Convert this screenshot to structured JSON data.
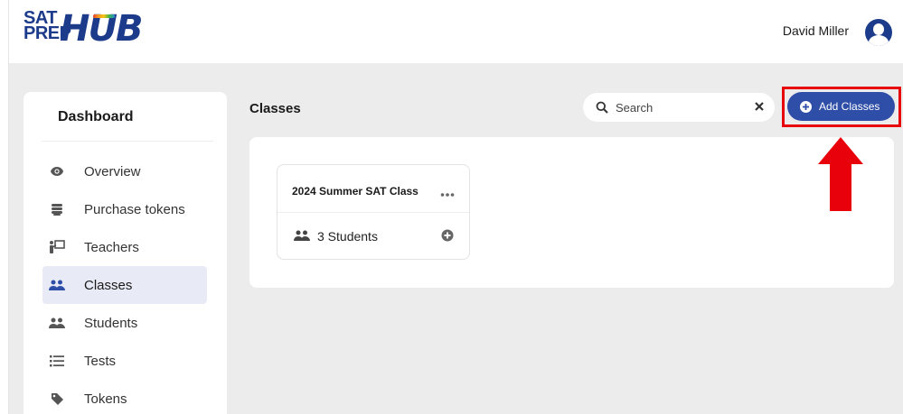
{
  "header": {
    "logo": {
      "line1": "SAT",
      "line2": "PREP",
      "brand": "HUB"
    },
    "user_name": "David Miller"
  },
  "sidebar": {
    "title": "Dashboard",
    "items": [
      {
        "label": "Overview",
        "icon": "eye-icon",
        "active": false
      },
      {
        "label": "Purchase tokens",
        "icon": "coins-icon",
        "active": false
      },
      {
        "label": "Teachers",
        "icon": "teacher-board-icon",
        "active": false
      },
      {
        "label": "Classes",
        "icon": "users-icon",
        "active": true
      },
      {
        "label": "Students",
        "icon": "users-icon",
        "active": false
      },
      {
        "label": "Tests",
        "icon": "list-icon",
        "active": false
      },
      {
        "label": "Tokens",
        "icon": "tag-icon",
        "active": false
      }
    ]
  },
  "main": {
    "title": "Classes",
    "search": {
      "placeholder": "Search",
      "value": ""
    },
    "add_button_label": "Add Classes",
    "cards": [
      {
        "title": "2024 Summer SAT Class",
        "students": "3 Students"
      }
    ]
  },
  "colors": {
    "brand": "#1d3b8b",
    "button": "#2e4ea8",
    "highlight": "#e8000b",
    "active_nav": "#e8eaf6",
    "background": "#ececec"
  }
}
